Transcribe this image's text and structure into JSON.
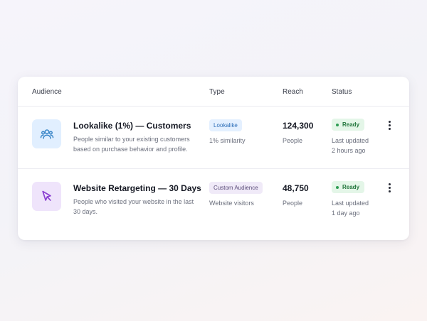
{
  "table": {
    "headers": {
      "audience": "Audience",
      "type": "Type",
      "reach": "Reach",
      "status": "Status"
    },
    "rows": [
      {
        "icon": "users-icon",
        "title": "Lookalike (1%) — Customers",
        "description": "People similar to your existing customers based on purchase behavior and profile.",
        "type_badge": "Lookalike",
        "type_detail": "1% similarity",
        "reach_value": "124,300",
        "reach_label": "People",
        "status": "Ready",
        "updated_label": "Last updated",
        "updated_time": "2 hours ago"
      },
      {
        "icon": "cursor-icon",
        "title": "Website Retargeting — 30 Days",
        "description": "People who visited your website in the last 30 days.",
        "type_badge": "Custom Audience",
        "type_detail": "Website visitors",
        "reach_value": "48,750",
        "reach_label": "People",
        "status": "Ready",
        "updated_label": "Last updated",
        "updated_time": "1 day ago"
      }
    ]
  },
  "colors": {
    "status_ready_bg": "#e4f6e8",
    "status_ready_text": "#22763c",
    "lookalike_tile": "#e1efff",
    "retargeting_tile": "#efe4fb",
    "users_icon": "#3a86c8",
    "cursor_icon": "#8a3fd1"
  }
}
